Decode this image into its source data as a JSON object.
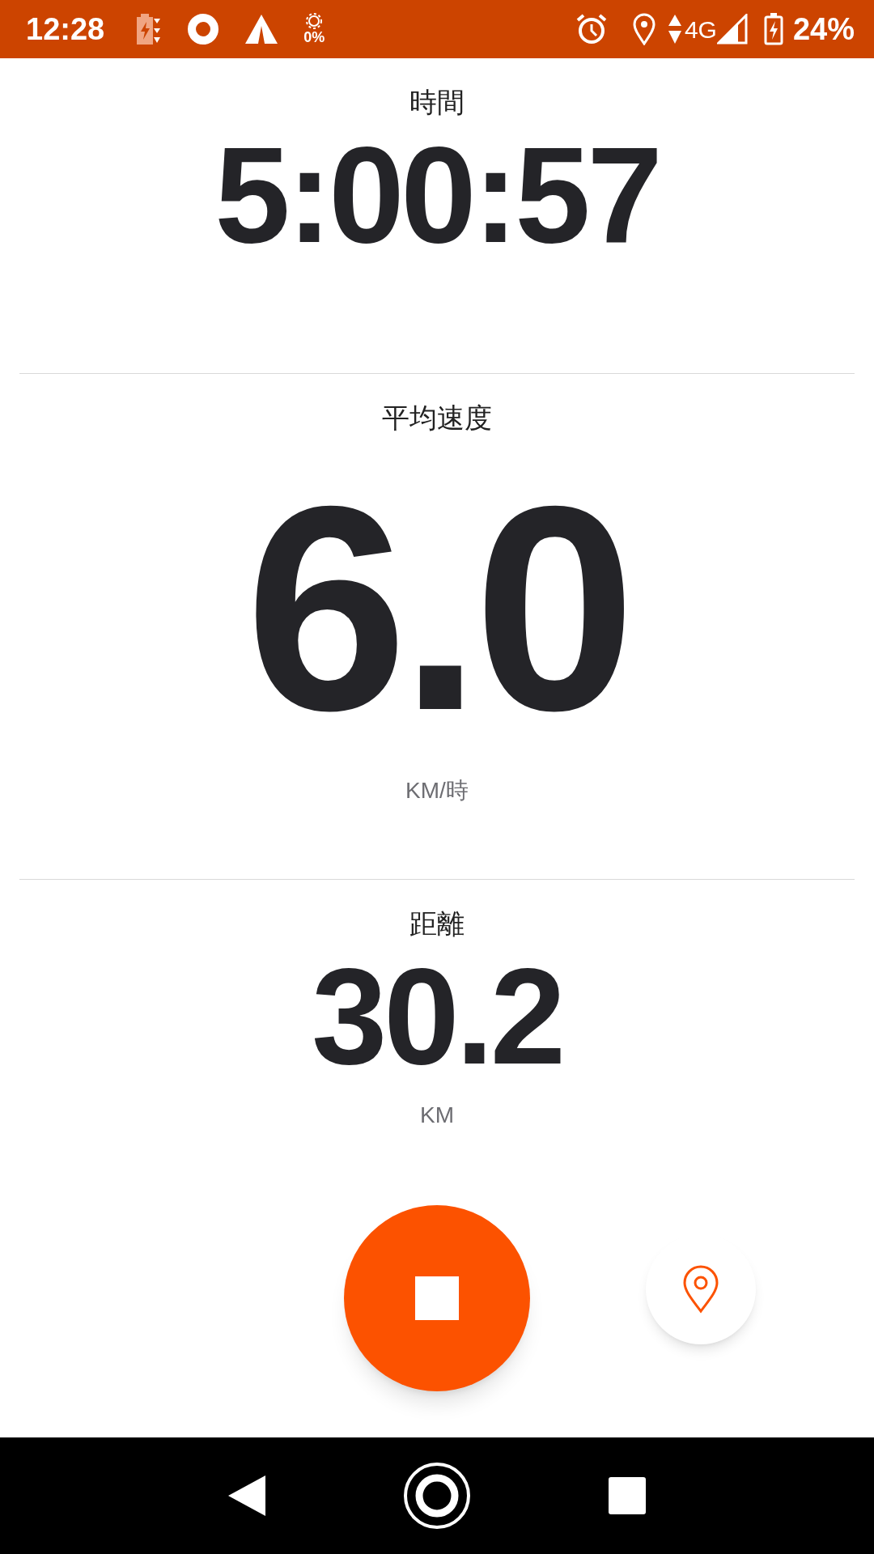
{
  "status_bar": {
    "time": "12:28",
    "brightness": "0%",
    "network": "4G",
    "battery": "24%"
  },
  "metrics": [
    {
      "kind": "medium",
      "label": "時間",
      "value": "5:00:57"
    },
    {
      "kind": "large",
      "label": "平均速度",
      "value": "6.0",
      "unit": "KM/時"
    },
    {
      "kind": "medium",
      "label": "距離",
      "value": "30.2",
      "unit": "KM"
    }
  ]
}
